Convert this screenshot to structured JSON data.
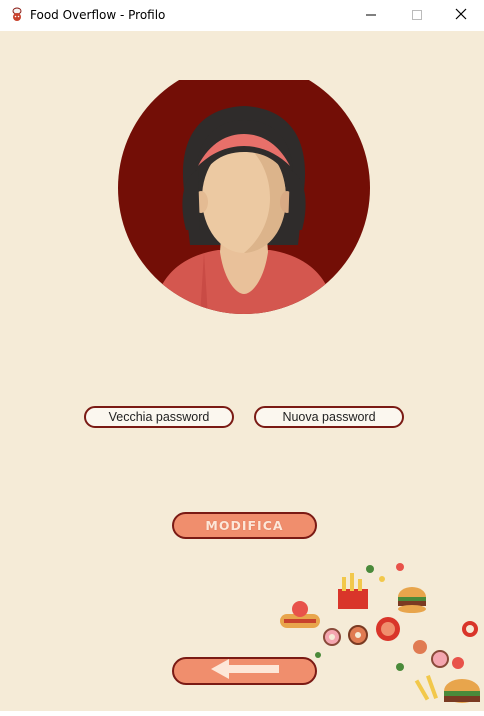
{
  "window": {
    "title": "Food Overflow - Profilo",
    "app_icon": "chef-app-icon",
    "controls": [
      "minimize-icon",
      "maximize-icon",
      "close-icon"
    ]
  },
  "profile": {
    "avatar": "woman-avatar"
  },
  "form": {
    "old_password_placeholder": "Vecchia password",
    "new_password_placeholder": "Nuova password",
    "submit_label": "MODIFICA",
    "back_icon": "arrow-left-icon"
  },
  "decor": {
    "illustration": "food-illustration"
  },
  "colors": {
    "background": "#f5ebd7",
    "avatar_circle": "#730e06",
    "button_fill": "#f08e6d",
    "button_border": "#7a1a14"
  }
}
